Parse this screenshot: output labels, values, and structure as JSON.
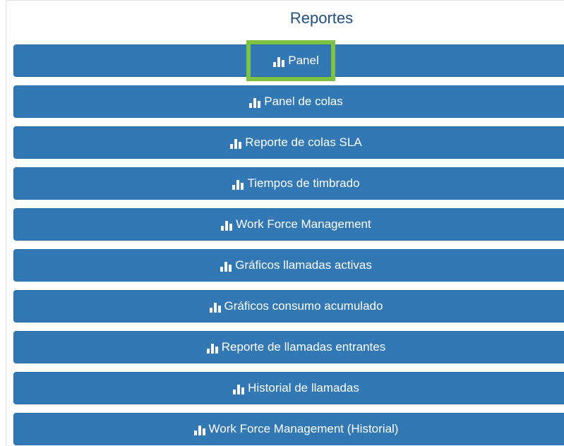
{
  "section": {
    "title": "Reportes"
  },
  "reports": [
    {
      "label": "Panel"
    },
    {
      "label": "Panel de colas"
    },
    {
      "label": "Reporte de colas SLA"
    },
    {
      "label": "Tiempos de timbrado"
    },
    {
      "label": "Work Force Management"
    },
    {
      "label": "Gráficos llamadas activas"
    },
    {
      "label": "Gráficos consumo acumulado"
    },
    {
      "label": "Reporte de llamadas entrantes"
    },
    {
      "label": "Historial de llamadas"
    },
    {
      "label": "Work Force Management (Historial)"
    }
  ],
  "icons": {
    "report_icon": "bar-chart-icon"
  },
  "colors": {
    "title": "#22507e",
    "button_bg": "#3278b5",
    "button_text": "#ffffff",
    "highlight": "#7dc242"
  }
}
